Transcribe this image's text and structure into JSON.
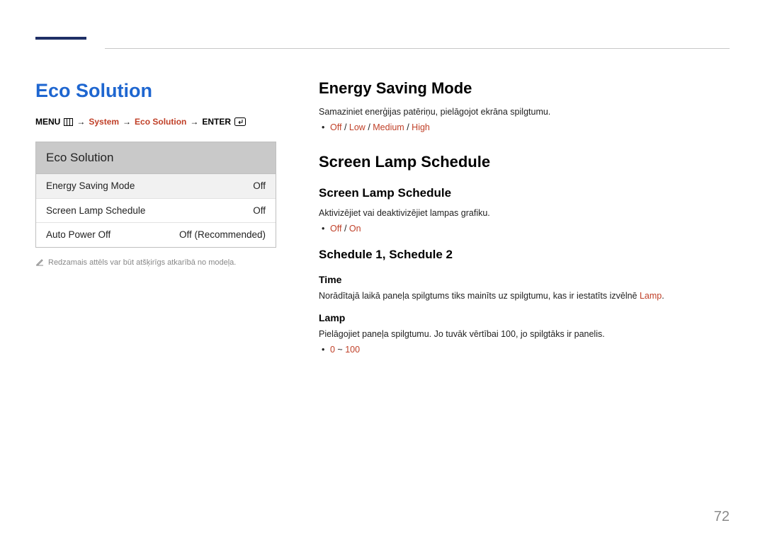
{
  "page_number": "72",
  "left": {
    "title": "Eco Solution",
    "breadcrumb": {
      "menu": "MENU",
      "system": "System",
      "eco": "Eco Solution",
      "enter": "ENTER"
    },
    "menu": {
      "title": "Eco Solution",
      "rows": [
        {
          "label": "Energy Saving Mode",
          "value": "Off"
        },
        {
          "label": "Screen Lamp Schedule",
          "value": "Off"
        },
        {
          "label": "Auto Power Off",
          "value": "Off (Recommended)"
        }
      ]
    },
    "footnote": "Redzamais attēls var būt atšķirīgs atkarībā no modeļa."
  },
  "right": {
    "energy": {
      "title": "Energy Saving Mode",
      "body": "Samaziniet enerģijas patēriņu, pielāgojot ekrāna spilgtumu.",
      "opt_off": "Off",
      "opt_low": "Low",
      "opt_med": "Medium",
      "opt_high": "High"
    },
    "sls": {
      "title": "Screen Lamp Schedule",
      "sub1_title": "Screen Lamp Schedule",
      "sub1_body": "Aktivizējiet vai deaktivizējiet lampas grafiku.",
      "sub1_off": "Off",
      "sub1_on": "On",
      "sub2_title": "Schedule 1, Schedule 2",
      "time_title": "Time",
      "time_body_pre": "Norādītajā laikā paneļa spilgtums tiks mainīts uz spilgtumu, kas ir iestatīts izvēlnē ",
      "time_body_accent": "Lamp",
      "time_body_post": ".",
      "lamp_title": "Lamp",
      "lamp_body": "Pielāgojiet paneļa spilgtumu. Jo tuvāk vērtībai 100, jo spilgtāks ir panelis.",
      "lamp_range_a": "0",
      "lamp_tilde": " ~ ",
      "lamp_range_b": "100"
    }
  }
}
